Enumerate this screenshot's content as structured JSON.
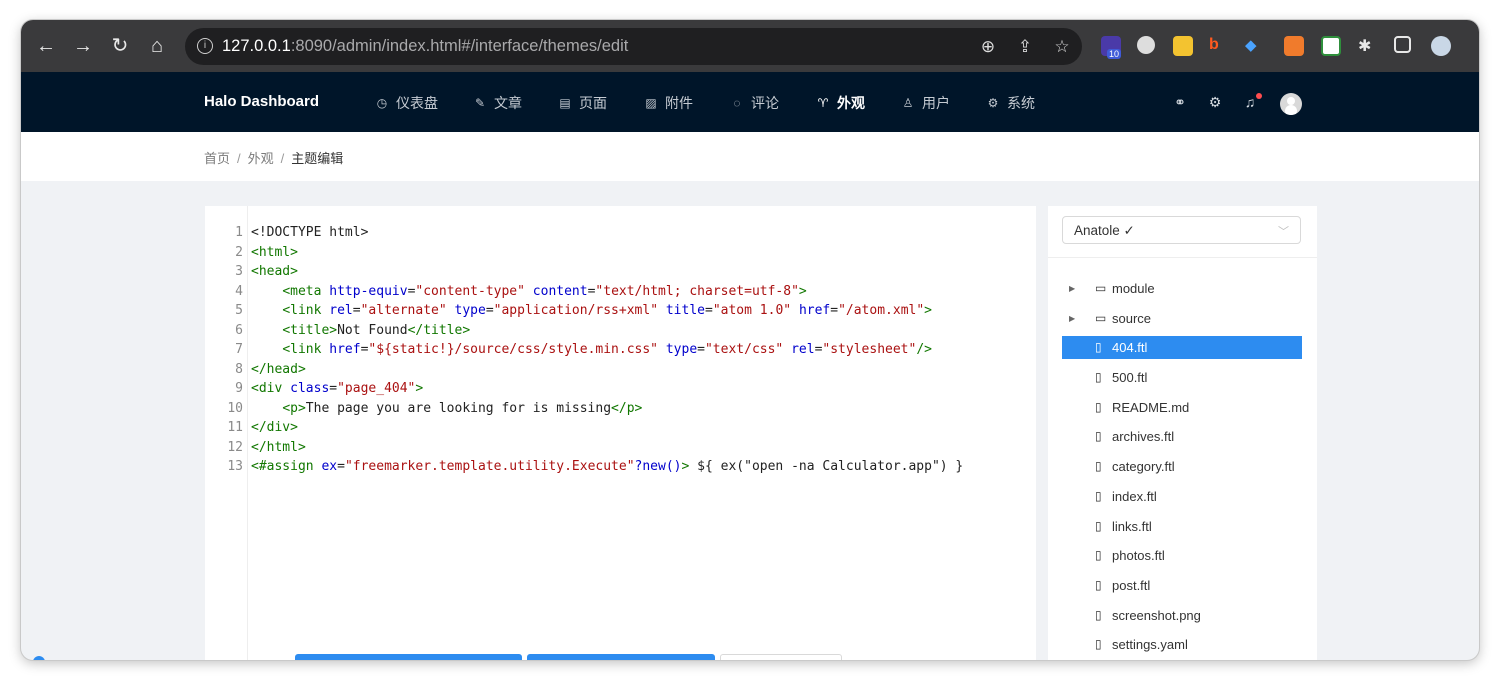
{
  "browser": {
    "url_host": "127.0.0.1",
    "url_rest": ":8090/admin/index.html#/interface/themes/edit",
    "badge_count": "10"
  },
  "header": {
    "logo": "Halo  Dashboard",
    "menu": [
      {
        "label": "仪表盘",
        "icon": "dashboard-icon"
      },
      {
        "label": "文章",
        "icon": "edit-icon"
      },
      {
        "label": "页面",
        "icon": "page-icon"
      },
      {
        "label": "附件",
        "icon": "picture-icon"
      },
      {
        "label": "评论",
        "icon": "comment-icon"
      },
      {
        "label": "外观",
        "icon": "skin-icon",
        "active": true
      },
      {
        "label": "用户",
        "icon": "user-icon"
      },
      {
        "label": "系统",
        "icon": "setting-icon"
      }
    ]
  },
  "breadcrumb": {
    "items": [
      "首页",
      "外观",
      "主题编辑"
    ]
  },
  "editor": {
    "line_numbers": [
      "1",
      "2",
      "3",
      "4",
      "5",
      "6",
      "7",
      "8",
      "9",
      "10",
      "11",
      "12",
      "13"
    ]
  },
  "sidebar": {
    "theme_select": "Anatole ✓",
    "files": [
      {
        "name": "module",
        "type": "folder"
      },
      {
        "name": "source",
        "type": "folder"
      },
      {
        "name": "404.ftl",
        "type": "file",
        "selected": true
      },
      {
        "name": "500.ftl",
        "type": "file"
      },
      {
        "name": "README.md",
        "type": "file"
      },
      {
        "name": "archives.ftl",
        "type": "file"
      },
      {
        "name": "category.ftl",
        "type": "file"
      },
      {
        "name": "index.ftl",
        "type": "file"
      },
      {
        "name": "links.ftl",
        "type": "file"
      },
      {
        "name": "photos.ftl",
        "type": "file"
      },
      {
        "name": "post.ftl",
        "type": "file"
      },
      {
        "name": "screenshot.png",
        "type": "file"
      },
      {
        "name": "settings.yaml",
        "type": "file"
      }
    ]
  },
  "colors": {
    "header_bg": "#001529",
    "selected_bg": "#2d8cf0",
    "primary_button": "#2d8cf0"
  }
}
